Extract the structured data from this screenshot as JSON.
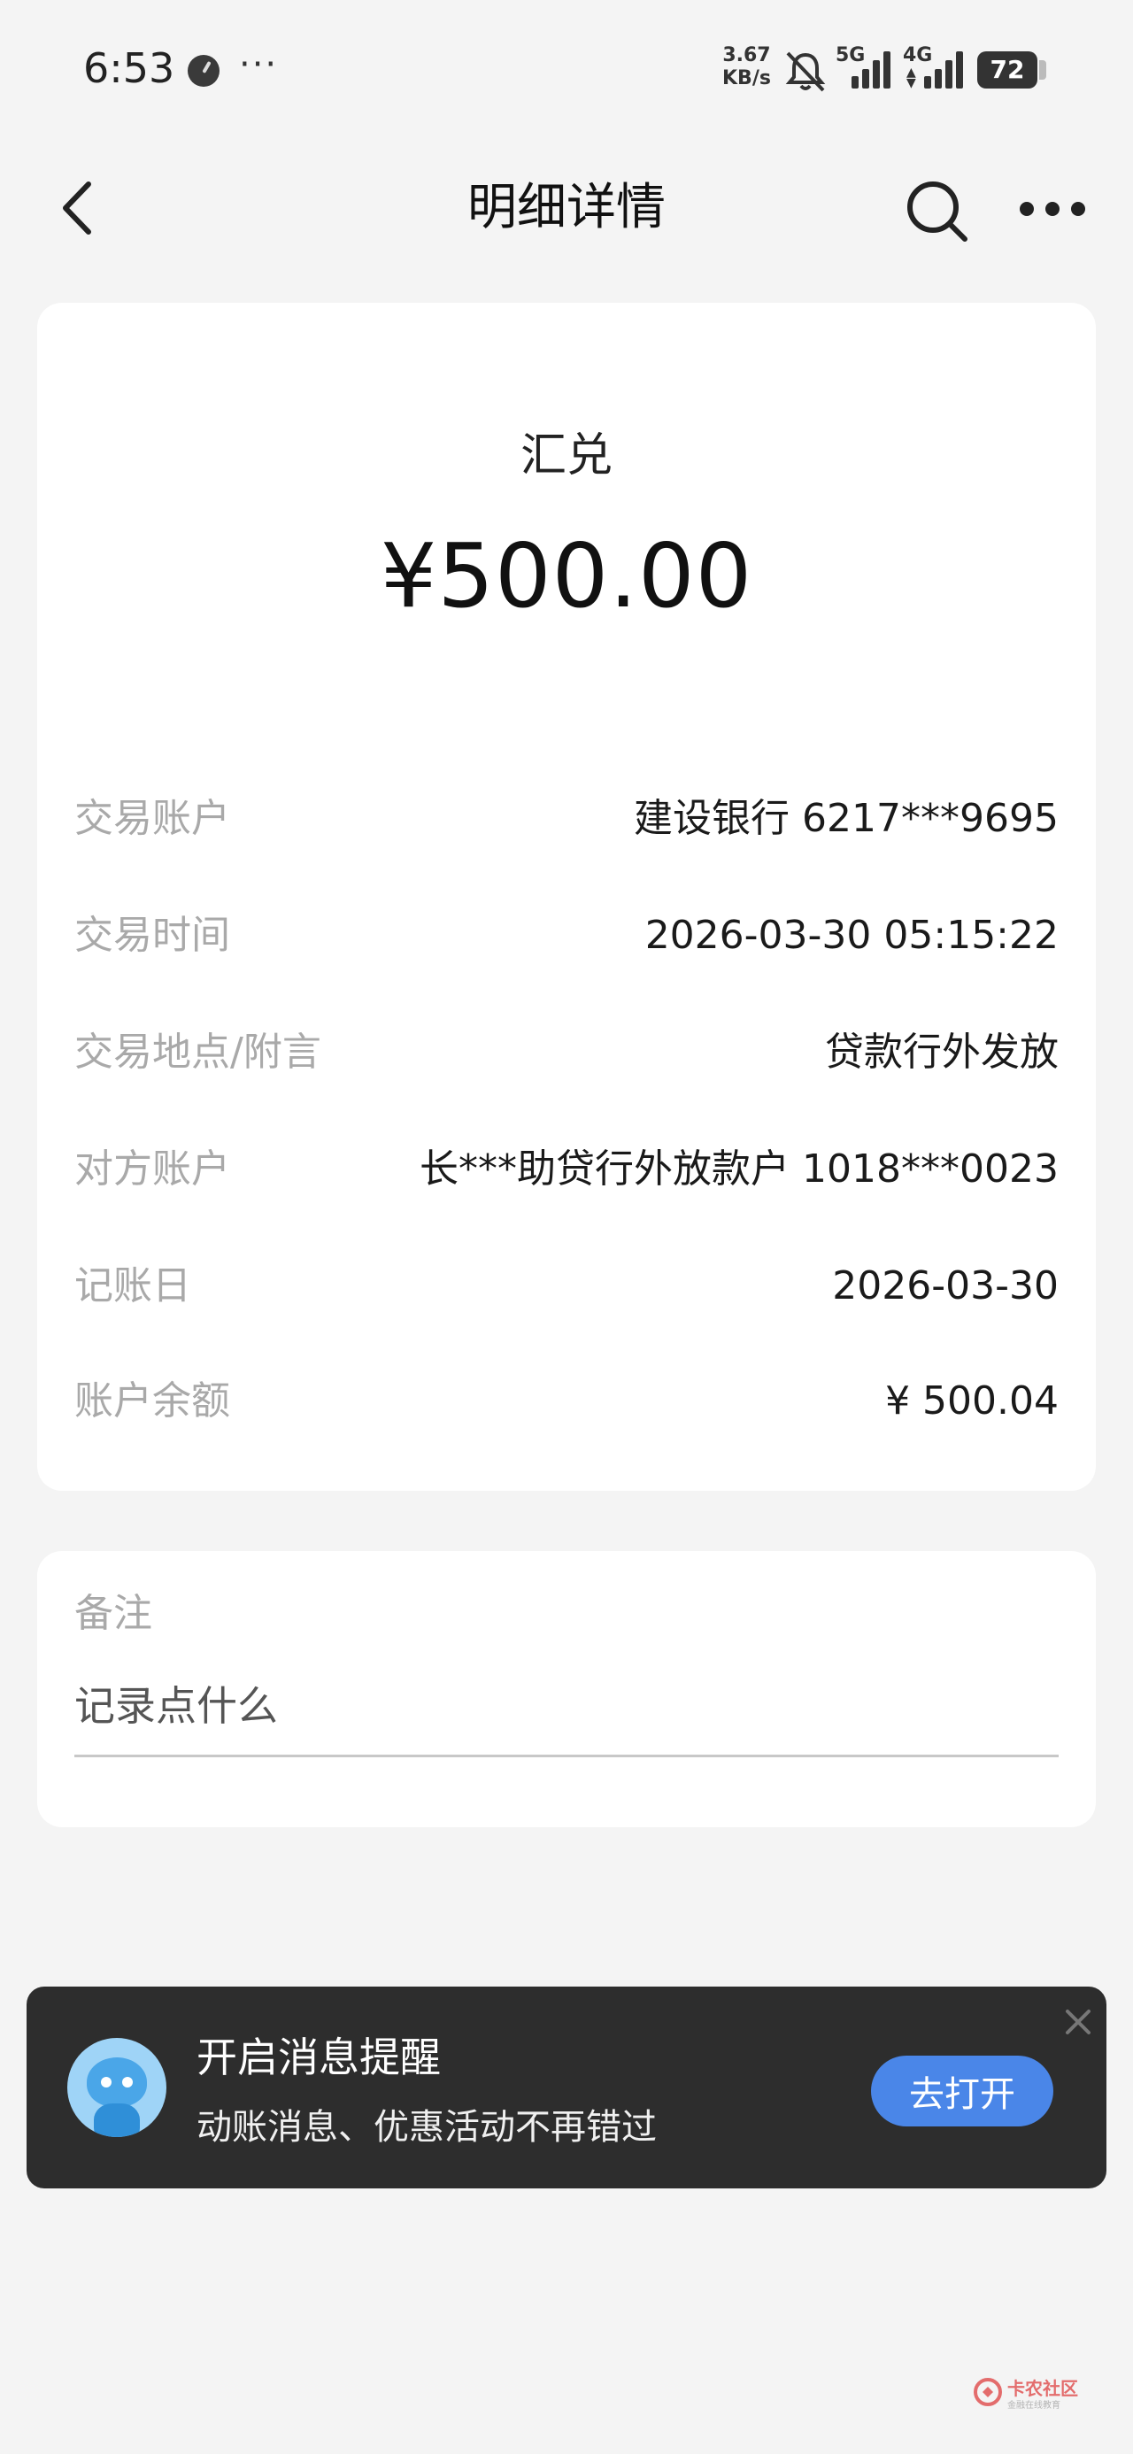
{
  "status_bar": {
    "time": "6:53",
    "net_speed_value": "3.67",
    "net_speed_unit": "KB/s",
    "sim1_label": "5G",
    "sim2_label": "4G",
    "battery": "72",
    "more_symbol": "···"
  },
  "nav": {
    "title": "明细详情",
    "back_icon": "chevron-left-icon",
    "search_icon": "search-icon",
    "more_icon": "more-dots-icon"
  },
  "transaction": {
    "type": "汇兑",
    "amount": "¥500.00",
    "rows": [
      {
        "label": "交易账户",
        "value": "建设银行 6217***9695"
      },
      {
        "label": "交易时间",
        "value": "2026-03-30 05:15:22"
      },
      {
        "label": "交易地点/附言",
        "value": "贷款行外发放"
      },
      {
        "label": "对方账户",
        "value": "长***助贷行外放款户 1018***0023"
      },
      {
        "label": "记账日",
        "value": "2026-03-30"
      },
      {
        "label": "账户余额",
        "value": "¥ 500.04"
      }
    ]
  },
  "remark": {
    "label": "备注",
    "placeholder": "记录点什么"
  },
  "notification": {
    "title": "开启消息提醒",
    "subtitle": "动账消息、优惠活动不再错过",
    "button": "去打开"
  },
  "watermark": {
    "name": "卡农社区",
    "tagline": "金融在线教育"
  }
}
